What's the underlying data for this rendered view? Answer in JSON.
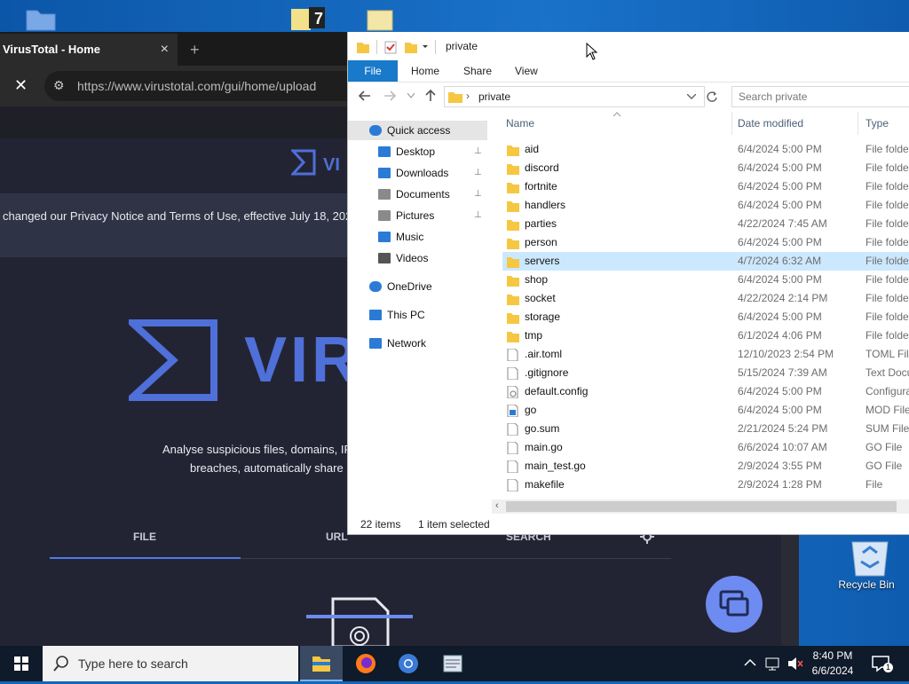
{
  "desktop": {
    "recycle_bin_label": "Recycle Bin"
  },
  "browser": {
    "tab_title": "VirusTotal - Home",
    "tab_close": "×",
    "new_tab": "+",
    "close_glyph": "✕",
    "tune_glyph": "⚙",
    "url": "https://www.virustotal.com/gui/home/upload",
    "notice": "changed our Privacy Notice and Terms of Use, effective July 18, 202",
    "brand_word": "VIRU",
    "small_brand_word": "VI",
    "description_line1": "Analyse suspicious files, domains, IF",
    "description_line2": "breaches, automatically share",
    "tabs": [
      "FILE",
      "URL",
      "SEARCH"
    ],
    "accent_color": "#4f7be8"
  },
  "explorer": {
    "title": "private",
    "ribbon_tabs": [
      "File",
      "Home",
      "Share",
      "View"
    ],
    "address_path": "private",
    "search_placeholder": "Search private",
    "columns": [
      "Name",
      "Date modified",
      "Type"
    ],
    "nav": [
      {
        "label": "Quick access",
        "icon": "star-icon",
        "pinned": false
      },
      {
        "label": "Desktop",
        "icon": "desktop-icon",
        "pinned": true
      },
      {
        "label": "Downloads",
        "icon": "download-icon",
        "pinned": true
      },
      {
        "label": "Documents",
        "icon": "documents-icon",
        "pinned": true
      },
      {
        "label": "Pictures",
        "icon": "pictures-icon",
        "pinned": true
      },
      {
        "label": "Music",
        "icon": "music-icon",
        "pinned": false
      },
      {
        "label": "Videos",
        "icon": "videos-icon",
        "pinned": false
      },
      {
        "label": "OneDrive",
        "icon": "cloud-icon",
        "pinned": false
      },
      {
        "label": "This PC",
        "icon": "pc-icon",
        "pinned": false
      },
      {
        "label": "Network",
        "icon": "network-icon",
        "pinned": false
      }
    ],
    "pin_glyph": "📌",
    "files": [
      {
        "name": "aid",
        "date": "6/4/2024 5:00 PM",
        "type": "File folder",
        "kind": "folder"
      },
      {
        "name": "discord",
        "date": "6/4/2024 5:00 PM",
        "type": "File folder",
        "kind": "folder"
      },
      {
        "name": "fortnite",
        "date": "6/4/2024 5:00 PM",
        "type": "File folder",
        "kind": "folder"
      },
      {
        "name": "handlers",
        "date": "6/4/2024 5:00 PM",
        "type": "File folder",
        "kind": "folder"
      },
      {
        "name": "parties",
        "date": "4/22/2024 7:45 AM",
        "type": "File folder",
        "kind": "folder"
      },
      {
        "name": "person",
        "date": "6/4/2024 5:00 PM",
        "type": "File folder",
        "kind": "folder"
      },
      {
        "name": "servers",
        "date": "4/7/2024 6:32 AM",
        "type": "File folder",
        "kind": "folder",
        "selected": true
      },
      {
        "name": "shop",
        "date": "6/4/2024 5:00 PM",
        "type": "File folder",
        "kind": "folder"
      },
      {
        "name": "socket",
        "date": "4/22/2024 2:14 PM",
        "type": "File folder",
        "kind": "folder"
      },
      {
        "name": "storage",
        "date": "6/4/2024 5:00 PM",
        "type": "File folder",
        "kind": "folder"
      },
      {
        "name": "tmp",
        "date": "6/1/2024 4:06 PM",
        "type": "File folder",
        "kind": "folder"
      },
      {
        "name": ".air.toml",
        "date": "12/10/2023 2:54 PM",
        "type": "TOML File",
        "kind": "file"
      },
      {
        "name": ".gitignore",
        "date": "5/15/2024 7:39 AM",
        "type": "Text Docu",
        "kind": "file"
      },
      {
        "name": "default.config",
        "date": "6/4/2024 5:00 PM",
        "type": "Configura",
        "kind": "config"
      },
      {
        "name": "go",
        "date": "6/4/2024 5:00 PM",
        "type": "MOD File",
        "kind": "mod"
      },
      {
        "name": "go.sum",
        "date": "2/21/2024 5:24 PM",
        "type": "SUM File",
        "kind": "file"
      },
      {
        "name": "main.go",
        "date": "6/6/2024 10:07 AM",
        "type": "GO File",
        "kind": "file"
      },
      {
        "name": "main_test.go",
        "date": "2/9/2024 3:55 PM",
        "type": "GO File",
        "kind": "file"
      },
      {
        "name": "makefile",
        "date": "2/9/2024 1:28 PM",
        "type": "File",
        "kind": "file"
      }
    ],
    "status_items": "22 items",
    "status_selected": "1 item selected"
  },
  "taskbar": {
    "search_placeholder": "Type here to search",
    "time": "8:40 PM",
    "date": "6/6/2024",
    "notification_count": "1"
  }
}
